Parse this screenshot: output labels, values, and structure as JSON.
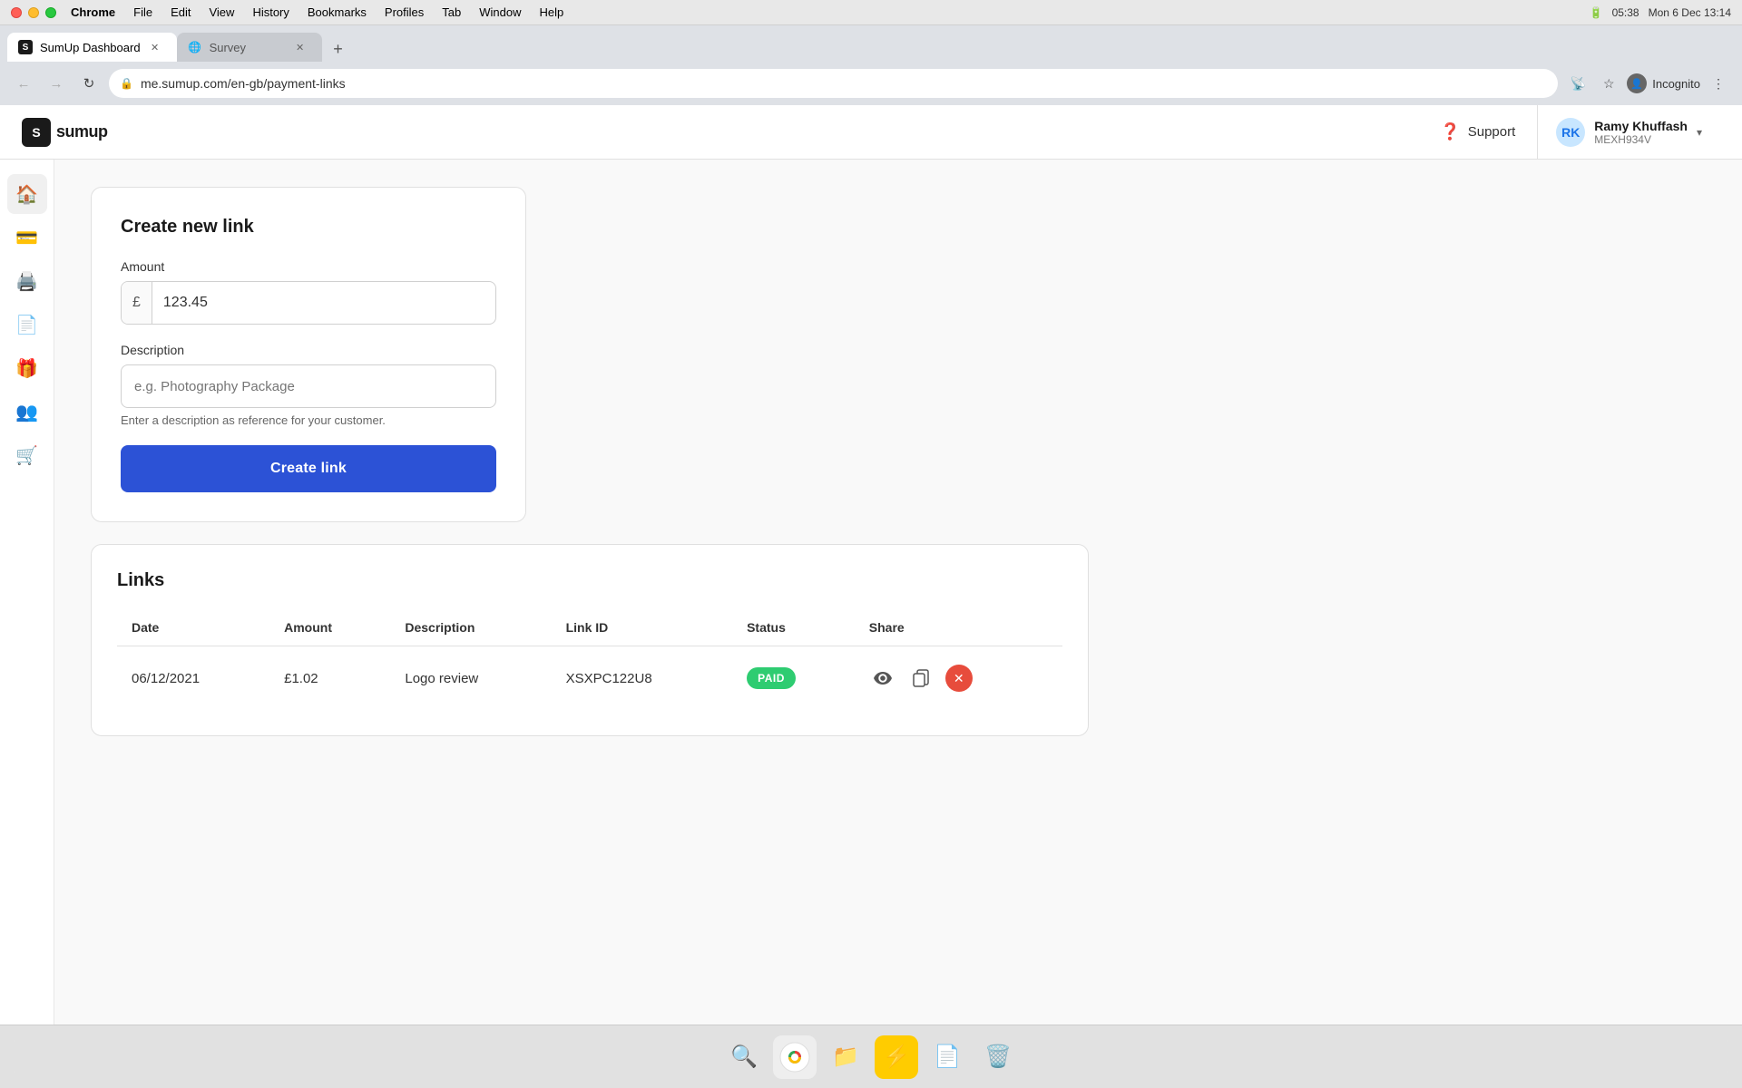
{
  "os": {
    "titlebar": {
      "chrome_label": "Chrome",
      "menus": [
        "File",
        "Edit",
        "View",
        "History",
        "Bookmarks",
        "Profiles",
        "Tab",
        "Window",
        "Help"
      ],
      "time": "Mon 6 Dec  13:14",
      "battery": "05:38"
    }
  },
  "browser": {
    "tabs": [
      {
        "id": "tab1",
        "title": "SumUp Dashboard",
        "active": true,
        "favicon": "S"
      },
      {
        "id": "tab2",
        "title": "Survey",
        "active": false,
        "favicon": "🌐"
      }
    ],
    "address": "me.sumup.com/en-gb/payment-links",
    "incognito_label": "Incognito"
  },
  "header": {
    "logo_text": "sumup",
    "logo_mark": "S",
    "support_label": "Support",
    "user": {
      "name": "Ramy Khuffash",
      "id": "MEXH934V",
      "avatar_initials": "RK"
    }
  },
  "sidebar": {
    "items": [
      {
        "icon": "🏠",
        "name": "home-icon"
      },
      {
        "icon": "💳",
        "name": "payments-icon"
      },
      {
        "icon": "🖨️",
        "name": "pos-icon"
      },
      {
        "icon": "📄",
        "name": "invoices-icon"
      },
      {
        "icon": "🎁",
        "name": "products-icon"
      },
      {
        "icon": "👥",
        "name": "customers-icon"
      },
      {
        "icon": "🛒",
        "name": "shop-icon"
      }
    ]
  },
  "create_link_form": {
    "card_title": "Create new link",
    "amount_label": "Amount",
    "amount_prefix": "£",
    "amount_value": "123.45",
    "description_label": "Description",
    "description_placeholder": "e.g. Photography Package",
    "description_hint": "Enter a description as reference for your customer.",
    "create_button_label": "Create link"
  },
  "links_table": {
    "section_title": "Links",
    "columns": [
      "Date",
      "Amount",
      "Description",
      "Link ID",
      "Status",
      "Share"
    ],
    "rows": [
      {
        "date": "06/12/2021",
        "amount": "£1.02",
        "description": "Logo review",
        "link_id": "XSXPC122U8",
        "status": "PAID",
        "status_color": "#2ecc71"
      }
    ]
  },
  "dock": {
    "items": [
      "🔍",
      "🌐",
      "📁",
      "⚡",
      "📄",
      "🗑️"
    ]
  }
}
